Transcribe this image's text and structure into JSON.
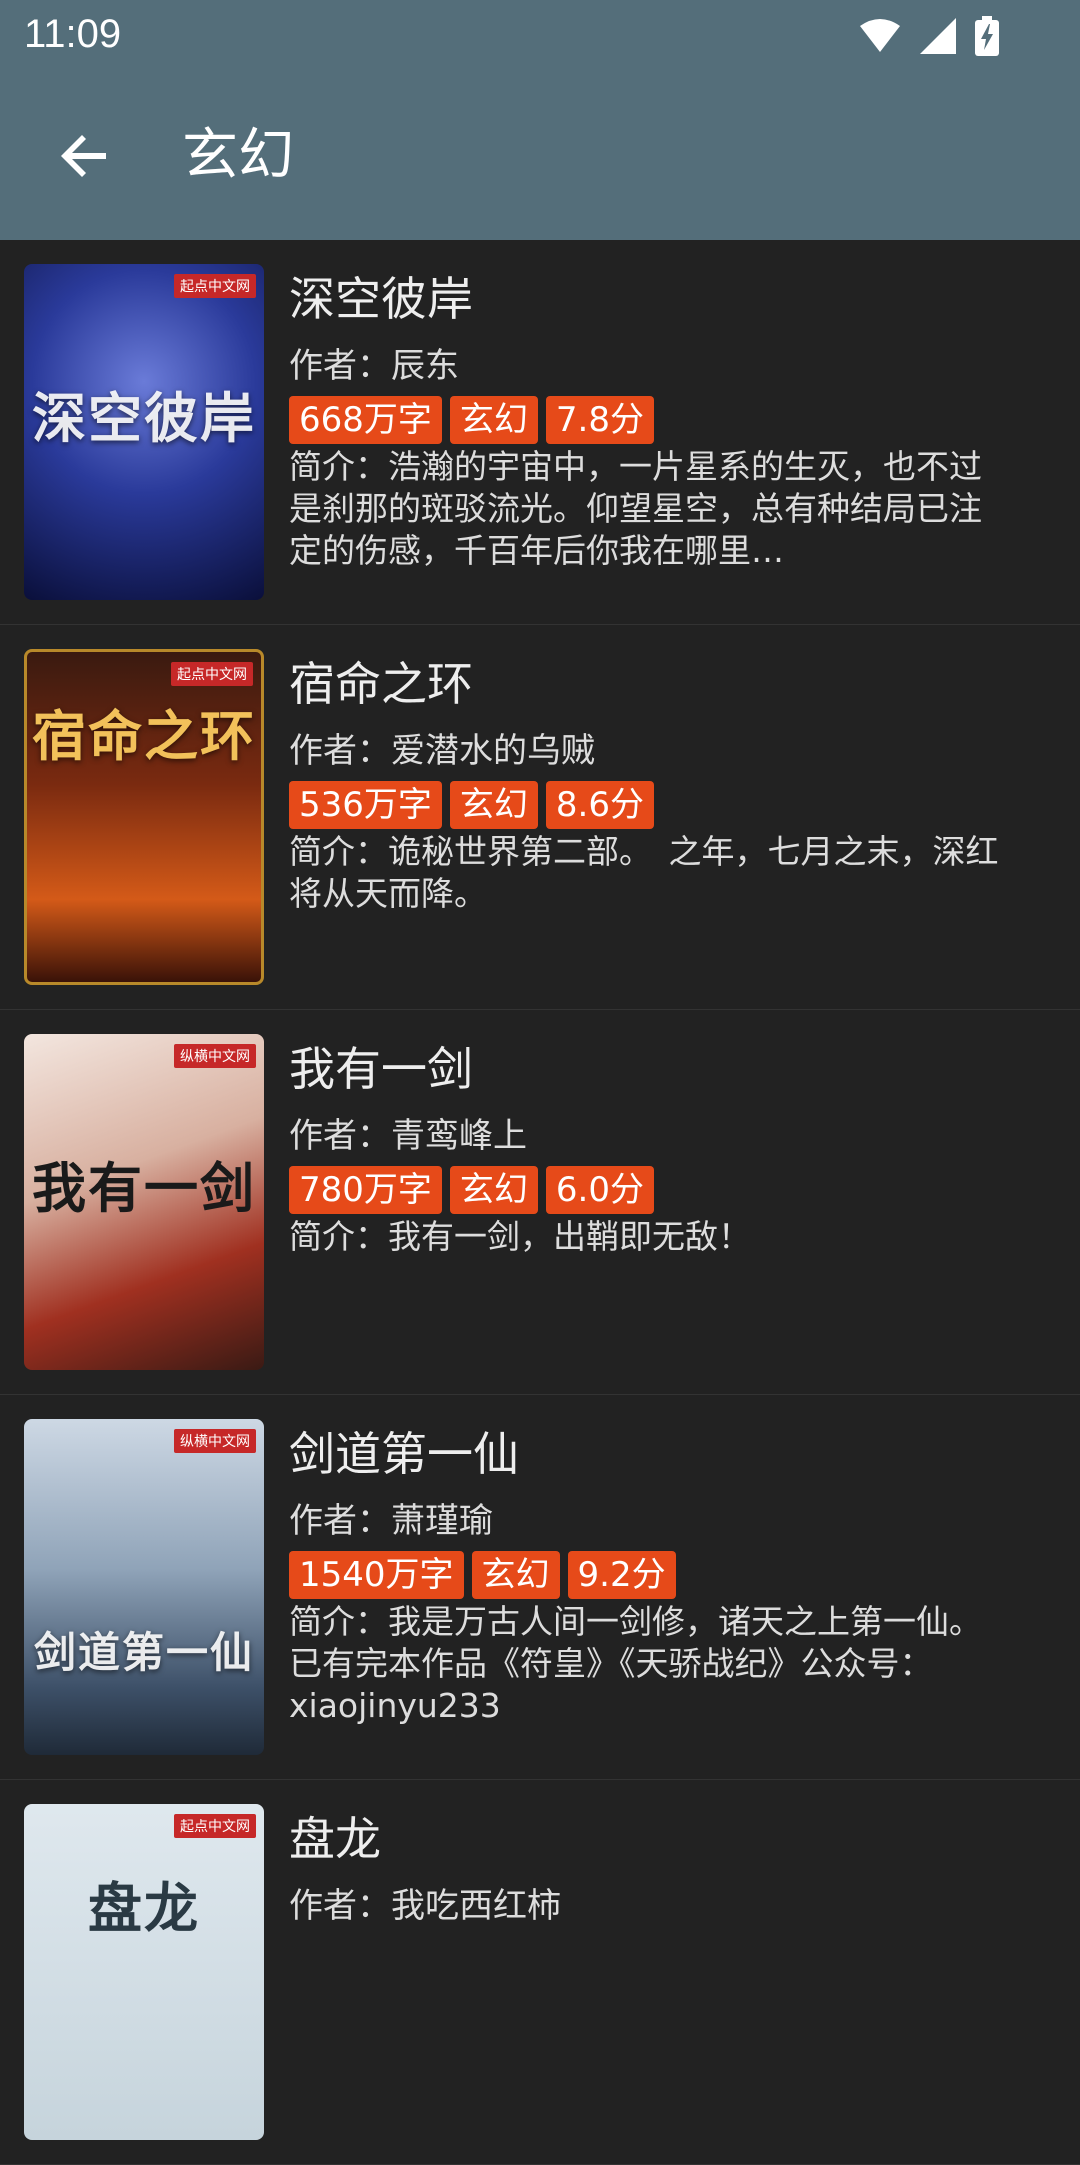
{
  "status_bar": {
    "time": "11:09",
    "icons": [
      "wifi-icon",
      "signal-icon",
      "battery-charging-icon"
    ]
  },
  "app_bar": {
    "title": "玄幻",
    "back_icon": "arrow-back-icon"
  },
  "colors": {
    "app_bar": "#546e7a",
    "background": "#222222",
    "tag": "#e64a19"
  },
  "books": [
    {
      "title": "深空彼岸",
      "author": "作者：辰东",
      "words": "668万字",
      "genre": "玄幻",
      "score": "7.8分",
      "intro": "简介：浩瀚的宇宙中，一片星系的生灭，也不过是刹那的斑驳流光。仰望星空，总有种结局已注定的伤感，千百年后你我在哪里…"
    },
    {
      "title": "宿命之环",
      "author": "作者：爱潜水的乌贼",
      "words": "536万字",
      "genre": "玄幻",
      "score": "8.6分",
      "intro": "简介：诡秘世界第二部。　之年，七月之末，深红将从天而降。"
    },
    {
      "title": "我有一剑",
      "author": "作者：青鸾峰上",
      "words": "780万字",
      "genre": "玄幻",
      "score": "6.0分",
      "intro": "简介：我有一剑，出鞘即无敌！"
    },
    {
      "title": "剑道第一仙",
      "author": "作者：萧瑾瑜",
      "words": "1540万字",
      "genre": "玄幻",
      "score": "9.2分",
      "intro": "简介：我是万古人间一剑修，诸天之上第一仙。已有完本作品《符皇》《天骄战纪》公众号：xiaojinyu233"
    },
    {
      "title": "盘龙",
      "author": "作者：我吃西红柿",
      "words": "",
      "genre": "",
      "score": "",
      "intro": ""
    }
  ],
  "covers": [
    {
      "title": "深空彼岸",
      "publisher": "起点中文网"
    },
    {
      "title": "宿命之环",
      "publisher": "起点中文网"
    },
    {
      "title": "我有一剑",
      "publisher": "纵横中文网"
    },
    {
      "title": "剑道第一仙",
      "publisher": "纵横中文网"
    },
    {
      "title": "盘龙",
      "publisher": "起点中文网"
    }
  ]
}
